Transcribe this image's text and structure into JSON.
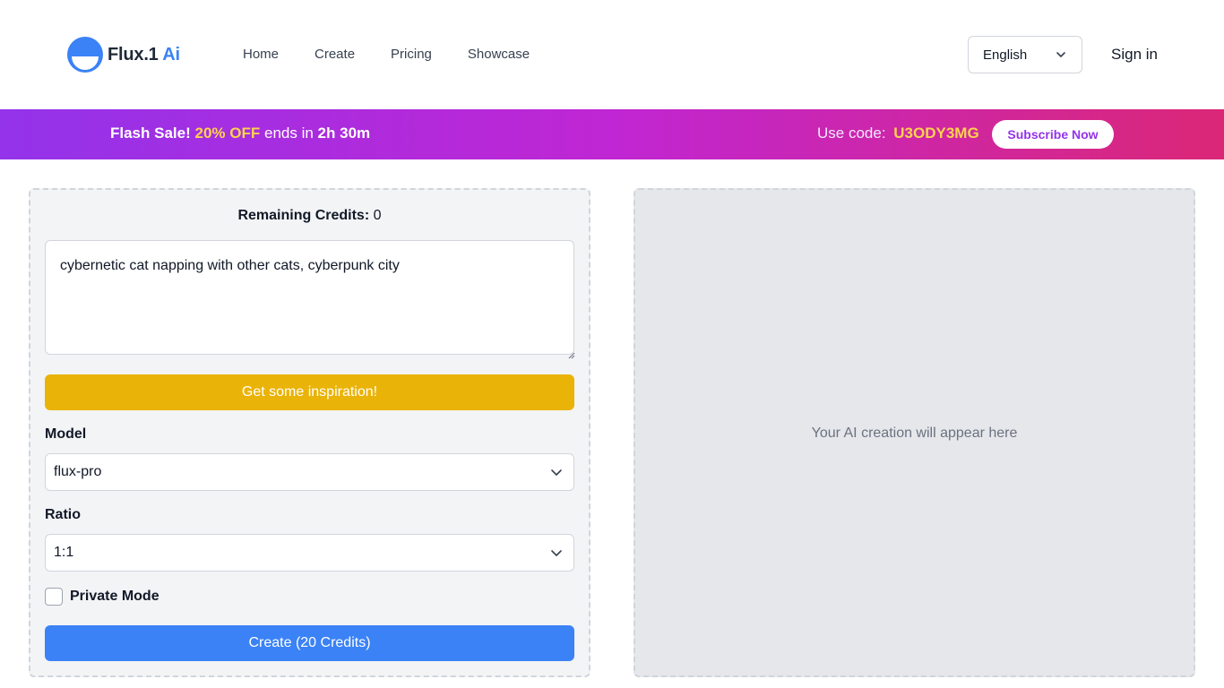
{
  "header": {
    "logo_brand": "Flux.1",
    "logo_ai": "Ai",
    "nav": [
      "Home",
      "Create",
      "Pricing",
      "Showcase"
    ],
    "language": "English",
    "sign_in": "Sign in"
  },
  "banner": {
    "flash_sale": "Flash Sale!",
    "discount": "20% OFF",
    "ends_in": "ends in",
    "countdown": "2h 30m",
    "use_code_label": "Use code:",
    "code": "U3ODY3MG",
    "subscribe_label": "Subscribe Now"
  },
  "form": {
    "credits_label": "Remaining Credits:",
    "credits_value": "0",
    "prompt_value": "cybernetic cat napping with other cats, cyberpunk city",
    "inspiration_label": "Get some inspiration!",
    "model_label": "Model",
    "model_value": "flux-pro",
    "ratio_label": "Ratio",
    "ratio_value": "1:1",
    "private_label": "Private Mode",
    "private_checked": false,
    "create_label": "Create (20 Credits)"
  },
  "preview": {
    "placeholder": "Your AI creation will appear here"
  },
  "colors": {
    "accent_blue": "#3b82f6",
    "inspire_yellow": "#eab308",
    "banner_start": "#9333ea",
    "banner_end": "#db2777",
    "highlight": "#fcd34d"
  },
  "icons": [
    "logo-icon",
    "chevron-down-icon",
    "resize-grip-icon"
  ]
}
